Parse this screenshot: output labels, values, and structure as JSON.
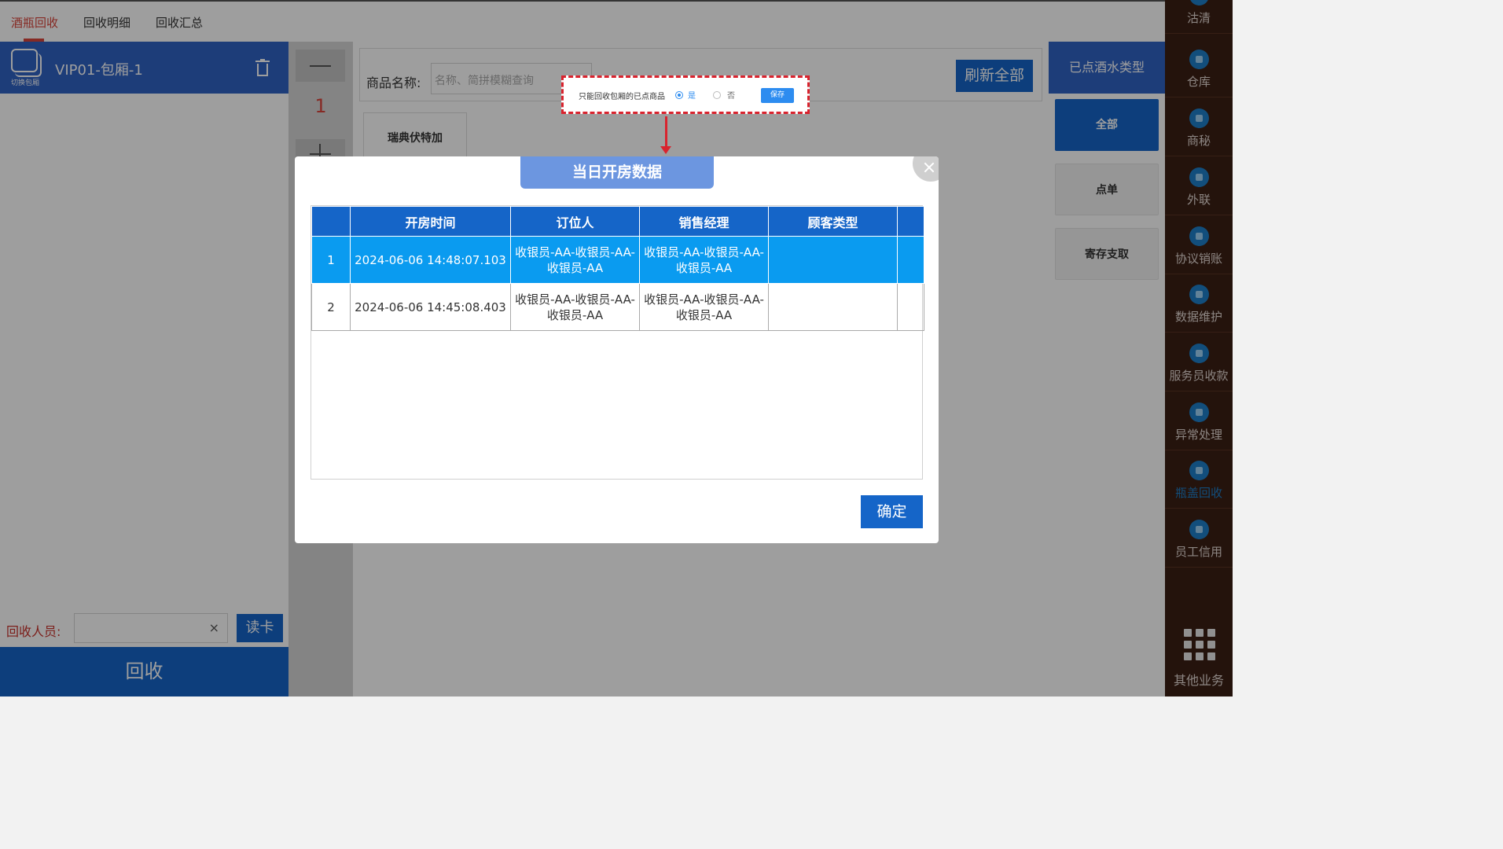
{
  "top_tabs": [
    {
      "label": "酒瓶回收",
      "active": true
    },
    {
      "label": "回收明细",
      "active": false
    },
    {
      "label": "回收汇总",
      "active": false
    }
  ],
  "room": {
    "switch_label": "切换包厢",
    "name": "VIP01-包厢-1"
  },
  "collector": {
    "label": "回收人员:",
    "value": "",
    "clear_icon": "×",
    "read_card_label": "读卡"
  },
  "recycle_button": "回收",
  "stepper": {
    "value": "1"
  },
  "search": {
    "label": "商品名称:",
    "placeholder": "名称、简拼模糊查询",
    "refresh_label": "刷新全部"
  },
  "categories": [
    {
      "label": "瑞典伏特加"
    }
  ],
  "right_panel": {
    "header": "已点酒水类型",
    "buttons": [
      {
        "label": "全部",
        "active": true
      },
      {
        "label": "点单",
        "active": false
      },
      {
        "label": "寄存支取",
        "active": false
      }
    ]
  },
  "sidebar": {
    "items": [
      {
        "label": "沽清",
        "icon": "clear-icon"
      },
      {
        "label": "仓库",
        "icon": "warehouse-icon"
      },
      {
        "label": "商秘",
        "icon": "download-icon"
      },
      {
        "label": "外联",
        "icon": "contact-icon"
      },
      {
        "label": "协议销账",
        "icon": "download-icon"
      },
      {
        "label": "数据维护",
        "icon": "pie-chart-icon"
      },
      {
        "label": "服务员收款",
        "icon": "waiter-icon"
      },
      {
        "label": "异常处理",
        "icon": "archive-icon"
      },
      {
        "label": "瓶盖回收",
        "icon": "bottle-cap-icon",
        "current": true
      },
      {
        "label": "员工信用",
        "icon": "credit-badge-icon"
      }
    ],
    "more_label": "其他业务"
  },
  "annotation": {
    "option_text": "只能回收包厢的已点商品",
    "yes_label": "是",
    "no_label": "否",
    "selected": "是",
    "save_label": "保存",
    "accent": "#d9232e"
  },
  "modal": {
    "title": "当日开房数据",
    "columns": [
      "",
      "开房时间",
      "订位人",
      "销售经理",
      "顾客类型",
      ""
    ],
    "rows": [
      {
        "no": "1",
        "time": "2024-06-06 14:48:07.103",
        "booker": "收银员-AA-收银员-AA-收银员-AA",
        "manager": "收银员-AA-收银员-AA-收银员-AA",
        "customer_type": "",
        "selected": true
      },
      {
        "no": "2",
        "time": "2024-06-06 14:45:08.403",
        "booker": "收银员-AA-收银员-AA-收银员-AA",
        "manager": "收银员-AA-收银员-AA-收银员-AA",
        "customer_type": "",
        "selected": false
      }
    ],
    "ok_label": "确定"
  },
  "colors": {
    "primary": "#1565c8",
    "header_blue": "#2f63c4",
    "selected_row": "#0a9bf0",
    "active_tab": "#d9443a",
    "sidebar_bg": "#3a1f14"
  }
}
